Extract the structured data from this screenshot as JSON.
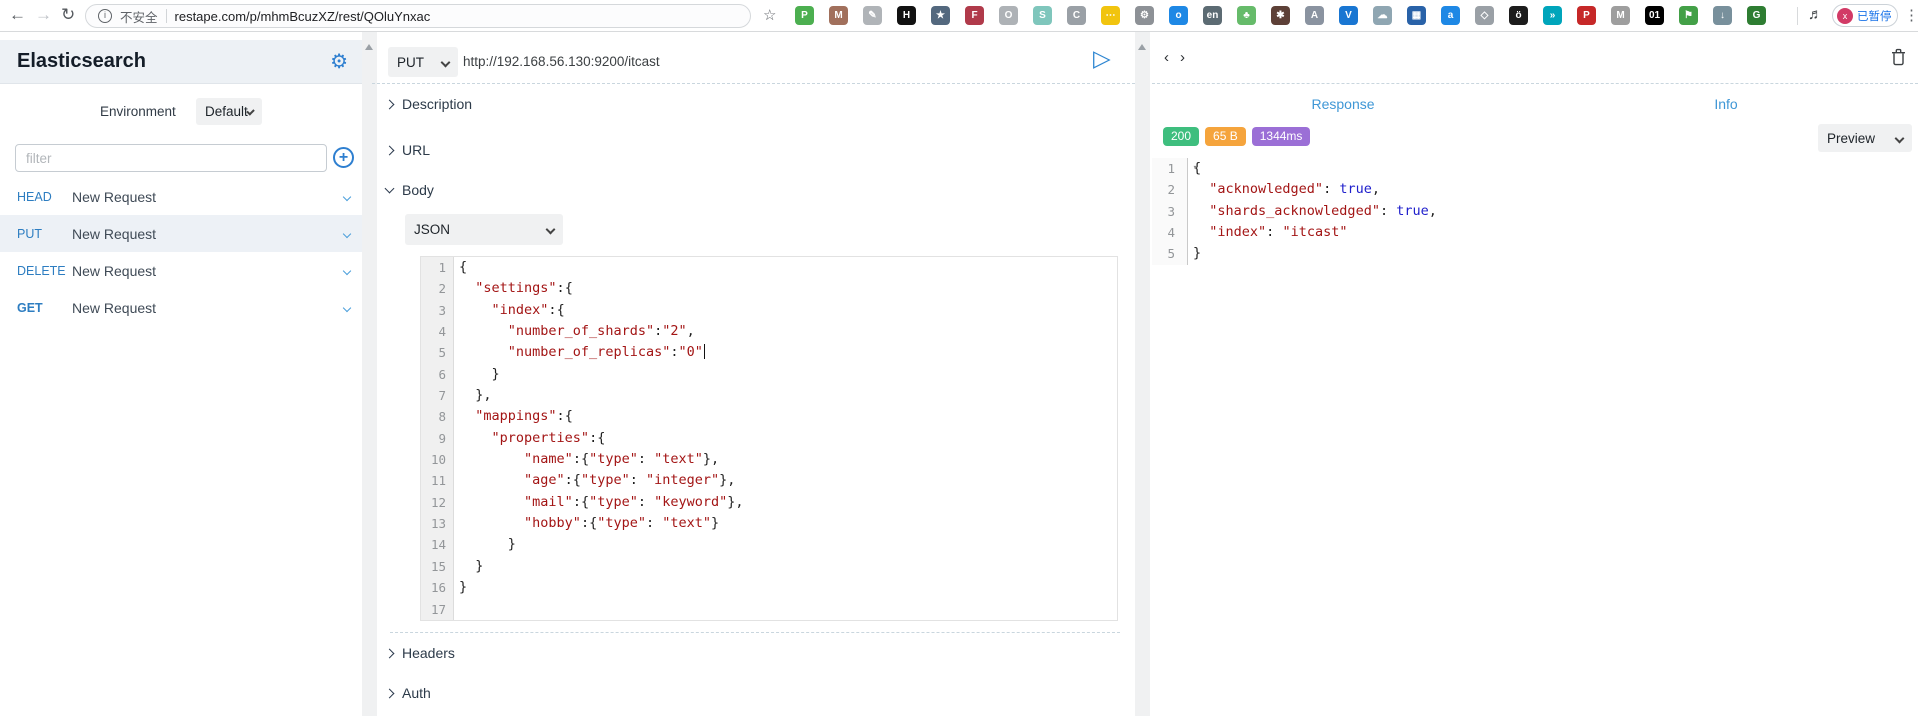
{
  "browser": {
    "back": "←",
    "forward": "→",
    "reload": "↻",
    "security_label": "不安全",
    "url": "restape.com/p/mhmBcuzXZ/rest/QOluYnxac",
    "star": "☆",
    "playlist_glyph": "♬",
    "paused_x": "x",
    "paused_label": "已暂停",
    "menu_dots": "⋮",
    "extensions": [
      {
        "n": "person-ext-icon",
        "g": "P",
        "c": "#4caf50"
      },
      {
        "n": "monkey-ext-icon",
        "g": "M",
        "c": "#a1705c"
      },
      {
        "n": "sketch-ext-icon",
        "g": "✎",
        "c": "#b0b4b8"
      },
      {
        "n": "h-ext-icon",
        "g": "H",
        "c": "#111111"
      },
      {
        "n": "star-badge-ext-icon",
        "g": "★",
        "c": "#53687e"
      },
      {
        "n": "flag-ext-icon",
        "g": "F",
        "c": "#b03a4a"
      },
      {
        "n": "ring-ext-icon",
        "g": "O",
        "c": "#aeb2b6"
      },
      {
        "n": "s-ext-icon",
        "g": "S",
        "c": "#7fc6bc"
      },
      {
        "n": "camera-ext-icon",
        "g": "C",
        "c": "#9aa0a6"
      },
      {
        "n": "dots-ext-icon",
        "g": "⋯",
        "c": "#f1c40f"
      },
      {
        "n": "gear-ext-icon",
        "g": "⚙",
        "c": "#8d9196"
      },
      {
        "n": "dot-ext-icon",
        "g": "o",
        "c": "#1e88e5"
      },
      {
        "n": "translate-ext-icon",
        "g": "en",
        "c": "#5c6b73"
      },
      {
        "n": "paw-ext-icon",
        "g": "♣",
        "c": "#66bb6a"
      },
      {
        "n": "mask-ext-icon",
        "g": "✱",
        "c": "#5d4037"
      },
      {
        "n": "artist-ext-icon",
        "g": "A",
        "c": "#8a93a0"
      },
      {
        "n": "v-ext-icon",
        "g": "V",
        "c": "#1976d2"
      },
      {
        "n": "cloud-ext-icon",
        "g": "☁",
        "c": "#8fa6b2"
      },
      {
        "n": "grid-ext-icon",
        "g": "▦",
        "c": "#2962a8"
      },
      {
        "n": "a-circle-ext-icon",
        "g": "a",
        "c": "#1e88e5"
      },
      {
        "n": "shield-ext-icon",
        "g": "◇",
        "c": "#9aa0a6"
      },
      {
        "n": "owl-ext-icon",
        "g": "ö",
        "c": "#1c1c1c"
      },
      {
        "n": "share-ext-icon",
        "g": "»",
        "c": "#00a5bb"
      },
      {
        "n": "pdf-ext-icon",
        "g": "P",
        "c": "#c62828"
      },
      {
        "n": "m-ext-icon",
        "g": "M",
        "c": "#9e9e9e"
      },
      {
        "n": "binary-ext-icon",
        "g": "01",
        "c": "#000000"
      },
      {
        "n": "flag2-ext-icon",
        "g": "⚑",
        "c": "#43a047"
      },
      {
        "n": "download-ext-icon",
        "g": "↓",
        "c": "#78909c"
      },
      {
        "n": "globe-ext-icon",
        "g": "G",
        "c": "#2e7d32"
      }
    ]
  },
  "icons": {
    "gear": "⚙",
    "add": "+",
    "send": "▷",
    "hist_back": "‹",
    "hist_forward": "›",
    "fold": "▾"
  },
  "colors": {
    "accent_blue": "#2e7fd0",
    "method_blue": "#2d7dc1",
    "tab_blue": "#3f97d6",
    "code_red": "#a31515",
    "code_blue": "#2020cc",
    "badge_green": "#3ebe7e",
    "badge_orange": "#f5a43c",
    "badge_purple": "#9b6fd6",
    "selected_row": "#edf1f6"
  },
  "sidebar": {
    "title": "Elasticsearch",
    "environment_label": "Environment",
    "environment_value": "Default",
    "filter_placeholder": "filter",
    "requests": [
      {
        "method": "HEAD",
        "label": "New Request",
        "selected": false,
        "bold": false
      },
      {
        "method": "PUT",
        "label": "New Request",
        "selected": true,
        "bold": false
      },
      {
        "method": "DELETE",
        "label": "New Request",
        "selected": false,
        "bold": false
      },
      {
        "method": "GET",
        "label": "New Request",
        "selected": false,
        "bold": true
      }
    ]
  },
  "request": {
    "method": "PUT",
    "url": "http://192.168.56.130:9200/itcast",
    "sections": {
      "description": "Description",
      "url": "URL",
      "body": "Body",
      "headers": "Headers",
      "auth": "Auth"
    },
    "body_type": "JSON",
    "body_lines": [
      {
        "n": 1,
        "s": [
          [
            "{",
            "p"
          ]
        ]
      },
      {
        "n": 2,
        "s": [
          [
            "  ",
            "p"
          ],
          [
            "\"settings\"",
            "r"
          ],
          [
            ":",
            "p"
          ],
          [
            "{",
            "p"
          ]
        ]
      },
      {
        "n": 3,
        "s": [
          [
            "    ",
            "p"
          ],
          [
            "\"index\"",
            "r"
          ],
          [
            ":",
            "p"
          ],
          [
            "{",
            "p"
          ]
        ]
      },
      {
        "n": 4,
        "s": [
          [
            "      ",
            "p"
          ],
          [
            "\"number_of_shards\"",
            "r"
          ],
          [
            ":",
            "p"
          ],
          [
            "\"2\"",
            "r"
          ],
          [
            ",",
            "p"
          ]
        ]
      },
      {
        "n": 5,
        "cursor": true,
        "s": [
          [
            "      ",
            "p"
          ],
          [
            "\"number_of_replicas\"",
            "r"
          ],
          [
            ":",
            "p"
          ],
          [
            "\"0\"",
            "r"
          ]
        ]
      },
      {
        "n": 6,
        "s": [
          [
            "    }",
            "p"
          ]
        ]
      },
      {
        "n": 7,
        "s": [
          [
            "  },",
            "p"
          ]
        ]
      },
      {
        "n": 8,
        "s": [
          [
            "  ",
            "p"
          ],
          [
            "\"mappings\"",
            "r"
          ],
          [
            ":",
            "p"
          ],
          [
            "{",
            "p"
          ]
        ]
      },
      {
        "n": 9,
        "s": [
          [
            "    ",
            "p"
          ],
          [
            "\"properties\"",
            "r"
          ],
          [
            ":",
            "p"
          ],
          [
            "{",
            "p"
          ]
        ]
      },
      {
        "n": 10,
        "s": [
          [
            "        ",
            "p"
          ],
          [
            "\"name\"",
            "r"
          ],
          [
            ":{",
            "p"
          ],
          [
            "\"type\"",
            "r"
          ],
          [
            ": ",
            "p"
          ],
          [
            "\"text\"",
            "r"
          ],
          [
            "},",
            "p"
          ]
        ]
      },
      {
        "n": 11,
        "s": [
          [
            "        ",
            "p"
          ],
          [
            "\"age\"",
            "r"
          ],
          [
            ":{",
            "p"
          ],
          [
            "\"type\"",
            "r"
          ],
          [
            ": ",
            "p"
          ],
          [
            "\"integer\"",
            "r"
          ],
          [
            "},",
            "p"
          ]
        ]
      },
      {
        "n": 12,
        "s": [
          [
            "        ",
            "p"
          ],
          [
            "\"mail\"",
            "r"
          ],
          [
            ":{",
            "p"
          ],
          [
            "\"type\"",
            "r"
          ],
          [
            ": ",
            "p"
          ],
          [
            "\"keyword\"",
            "r"
          ],
          [
            "},",
            "p"
          ]
        ]
      },
      {
        "n": 13,
        "s": [
          [
            "        ",
            "p"
          ],
          [
            "\"hobby\"",
            "r"
          ],
          [
            ":{",
            "p"
          ],
          [
            "\"type\"",
            "r"
          ],
          [
            ": ",
            "p"
          ],
          [
            "\"text\"",
            "r"
          ],
          [
            "}",
            "p"
          ]
        ]
      },
      {
        "n": 14,
        "s": [
          [
            "      }",
            "p"
          ]
        ]
      },
      {
        "n": 15,
        "s": [
          [
            "  }",
            "p"
          ]
        ]
      },
      {
        "n": 16,
        "s": [
          [
            "}",
            "p"
          ]
        ]
      },
      {
        "n": 17,
        "s": []
      }
    ]
  },
  "response": {
    "tab_response": "Response",
    "tab_info": "Info",
    "status_code": "200",
    "size": "65 B",
    "time": "1344ms",
    "view_mode": "Preview",
    "body_lines": [
      {
        "n": 1,
        "fold": true,
        "s": [
          [
            "{",
            "p"
          ]
        ]
      },
      {
        "n": 2,
        "s": [
          [
            "  ",
            "p"
          ],
          [
            "\"acknowledged\"",
            "r"
          ],
          [
            ": ",
            "p"
          ],
          [
            "true",
            "b"
          ],
          [
            ",",
            "p"
          ]
        ]
      },
      {
        "n": 3,
        "s": [
          [
            "  ",
            "p"
          ],
          [
            "\"shards_acknowledged\"",
            "r"
          ],
          [
            ": ",
            "p"
          ],
          [
            "true",
            "b"
          ],
          [
            ",",
            "p"
          ]
        ]
      },
      {
        "n": 4,
        "s": [
          [
            "  ",
            "p"
          ],
          [
            "\"index\"",
            "r"
          ],
          [
            ": ",
            "p"
          ],
          [
            "\"itcast\"",
            "r"
          ]
        ]
      },
      {
        "n": 5,
        "s": [
          [
            "}",
            "p"
          ]
        ]
      }
    ]
  }
}
